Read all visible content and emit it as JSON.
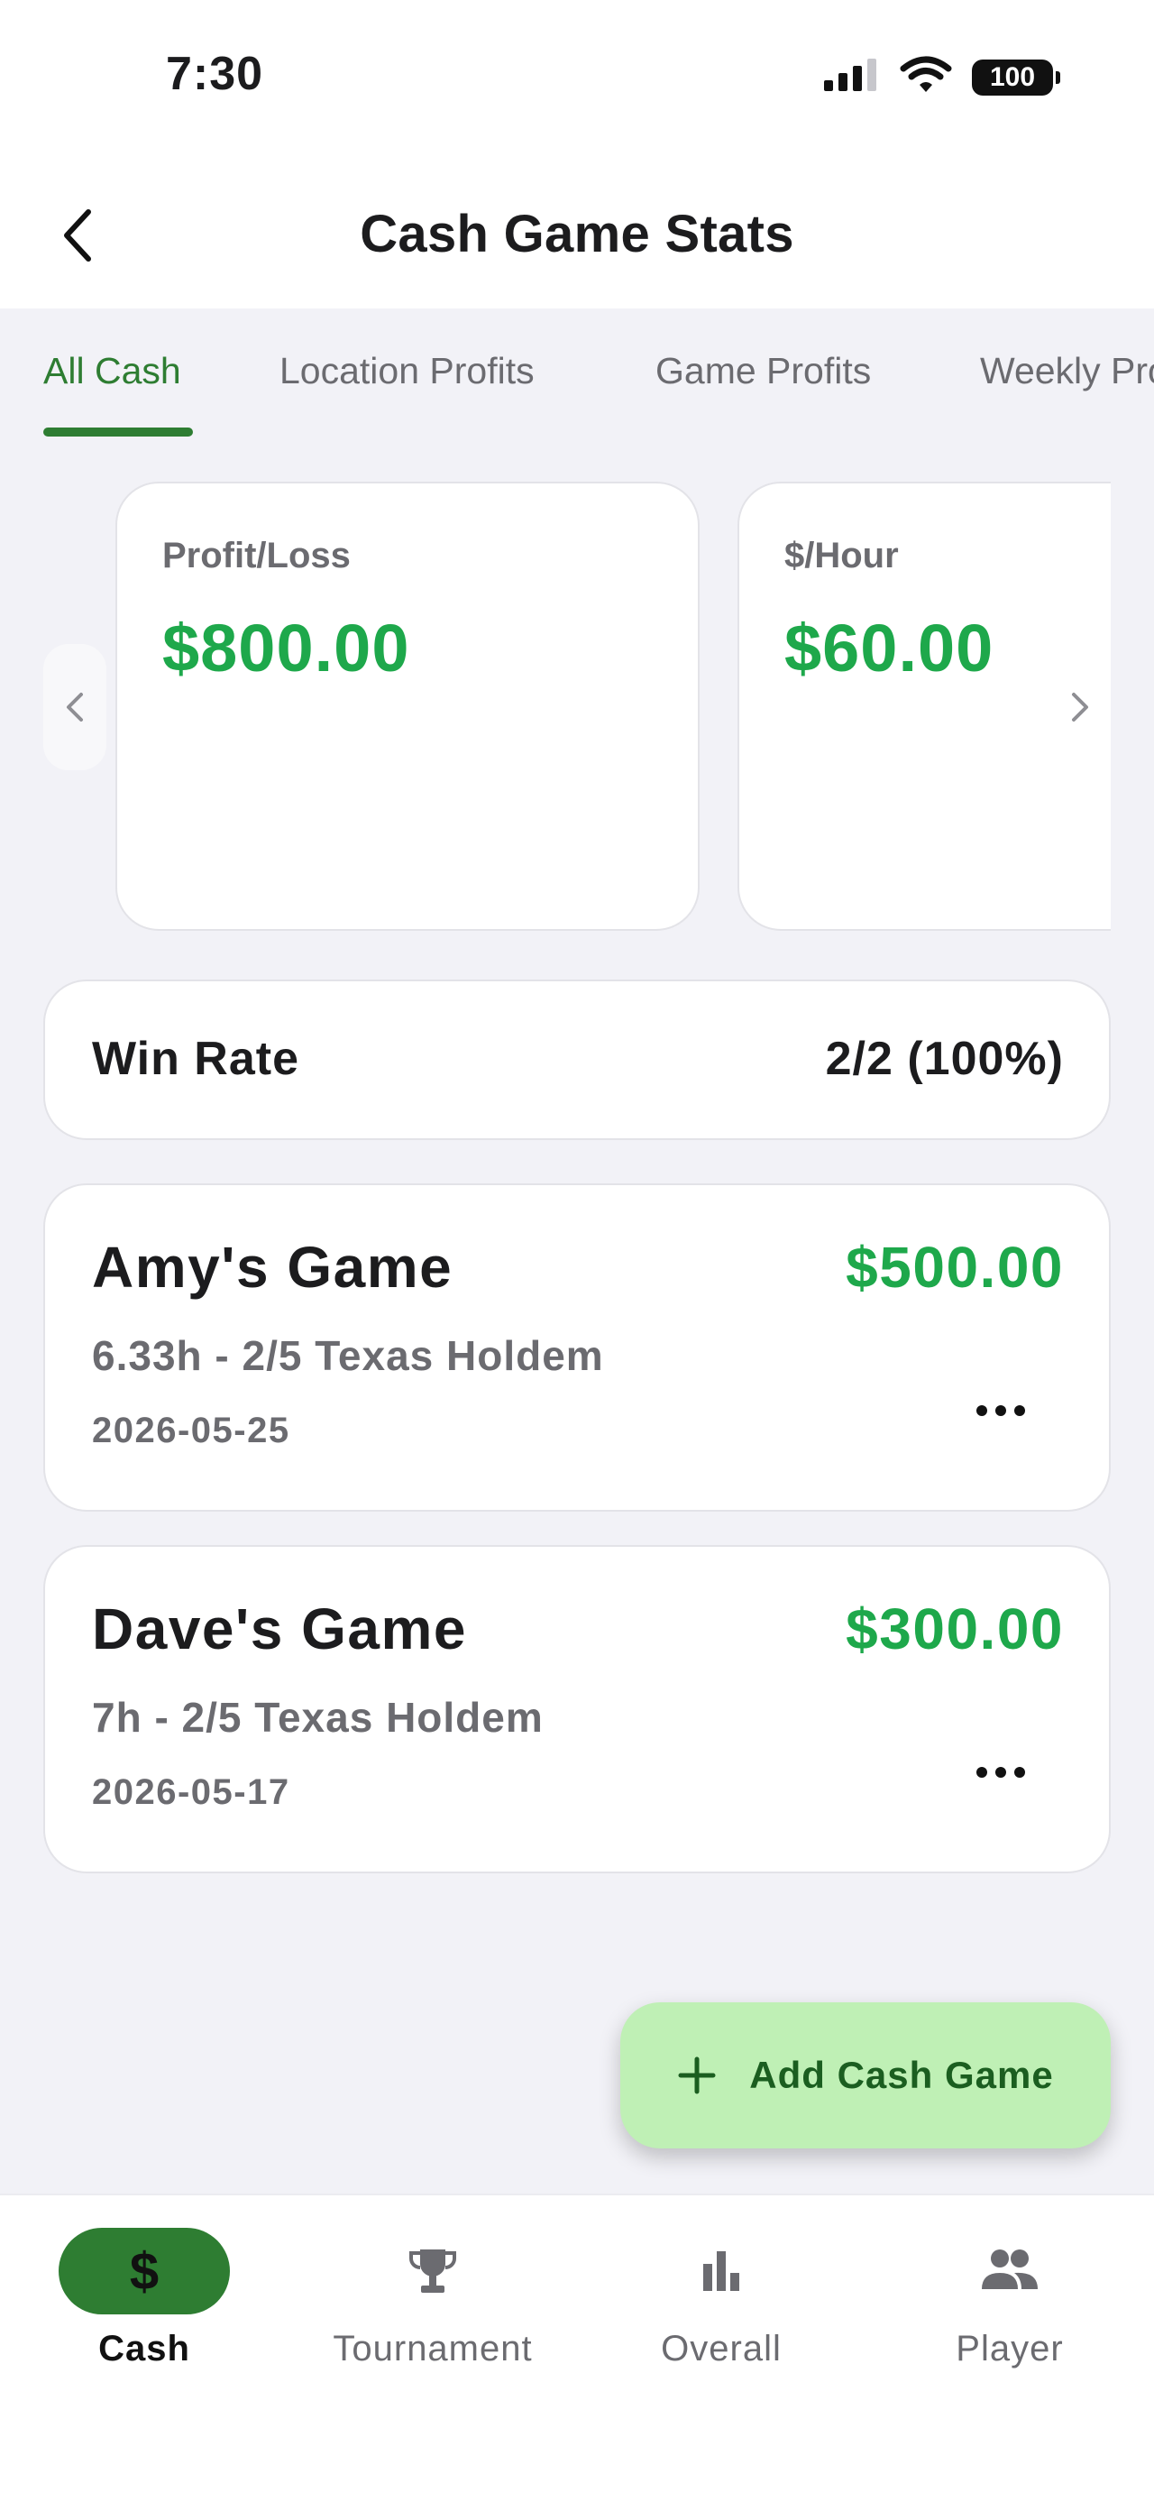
{
  "status_bar": {
    "time": "7:30",
    "battery": "100"
  },
  "header": {
    "title": "Cash Game Stats"
  },
  "tabs": [
    {
      "label": "All Cash",
      "active": true
    },
    {
      "label": "Location Profits",
      "active": false
    },
    {
      "label": "Game Profits",
      "active": false
    },
    {
      "label": "Weekly Profits",
      "active": false
    }
  ],
  "stats": [
    {
      "label": "Profit/Loss",
      "value": "$800.00"
    },
    {
      "label": "$/Hour",
      "value": "$60.00"
    }
  ],
  "win_rate": {
    "label": "Win Rate",
    "value": "2/2 (100%)"
  },
  "games": [
    {
      "name": "Amy's Game",
      "amount": "$500.00",
      "details": "6.33h - 2/5 Texas Holdem",
      "date": "2026-05-25"
    },
    {
      "name": "Dave's Game",
      "amount": "$300.00",
      "details": "7h - 2/5 Texas Holdem",
      "date": "2026-05-17"
    }
  ],
  "fab": {
    "label": "Add Cash Game"
  },
  "bottom_nav": [
    {
      "label": "Cash",
      "icon": "dollar-icon",
      "active": true
    },
    {
      "label": "Tournament",
      "icon": "trophy-icon",
      "active": false
    },
    {
      "label": "Overall",
      "icon": "bar-chart-icon",
      "active": false
    },
    {
      "label": "Player",
      "icon": "people-icon",
      "active": false
    }
  ],
  "colors": {
    "accent": "#2e7d32",
    "profit": "#1ea84b",
    "fab_bg": "#bff0b5",
    "background": "#f2f2f7"
  }
}
